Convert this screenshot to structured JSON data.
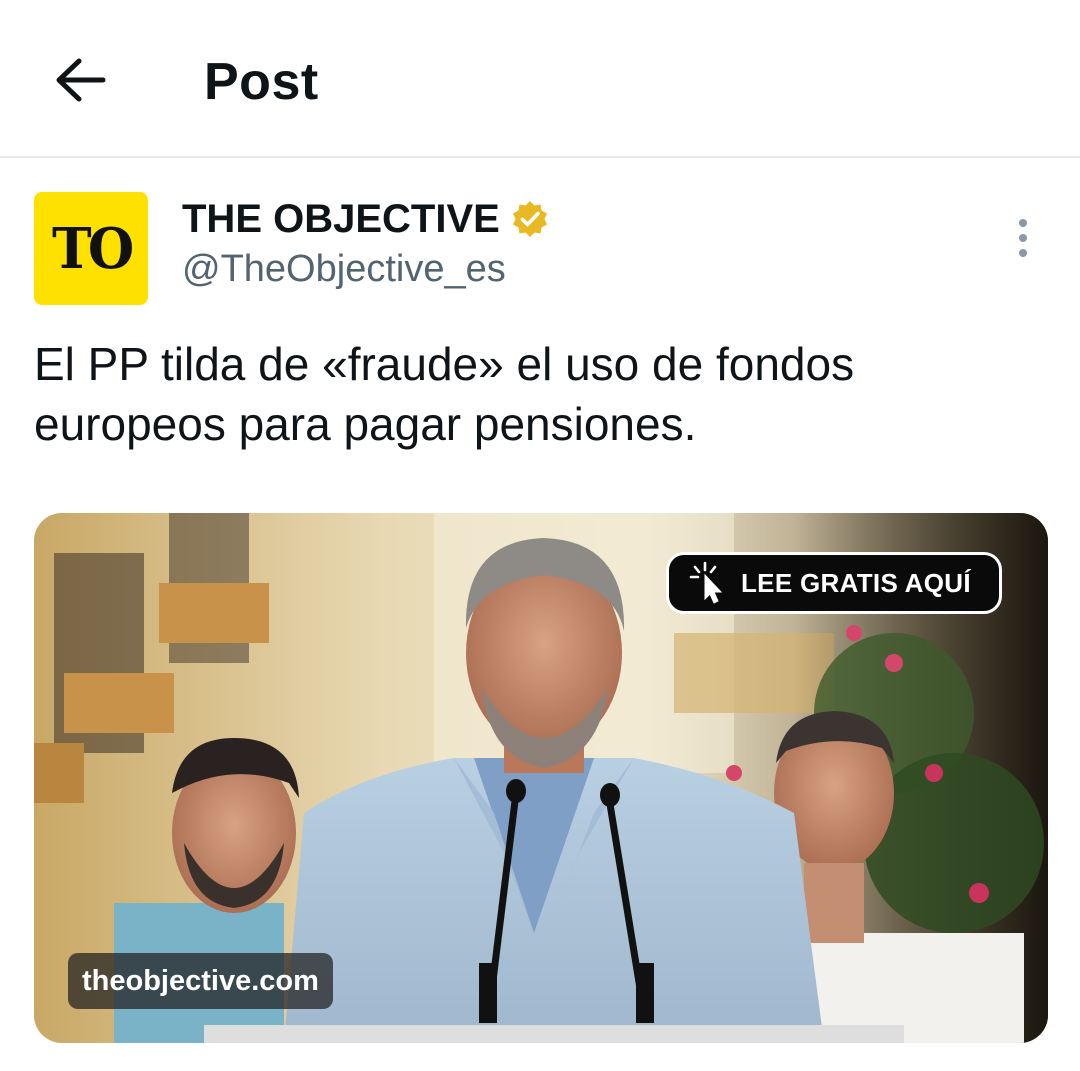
{
  "header": {
    "title": "Post",
    "back_icon": "arrow-left-icon"
  },
  "author": {
    "avatar_text": "TO",
    "avatar_color": "#ffe100",
    "display_name": "THE OBJECTIVE",
    "verified_icon": "gold-verified-badge-icon",
    "verified_color": "#e8b923",
    "handle": "@TheObjective_es",
    "more_icon": "more-vertical-icon"
  },
  "tweet": {
    "text": "El PP tilda de «fraude» el uso de fondos europeos para pagar pensiones."
  },
  "media": {
    "cta_label": "LEE GRATIS AQUÍ",
    "cta_icon": "cursor-click-icon",
    "domain": "theobjective.com"
  },
  "colors": {
    "text_primary": "#0f1419",
    "text_secondary": "#536471",
    "divider": "#e7e9ea"
  }
}
